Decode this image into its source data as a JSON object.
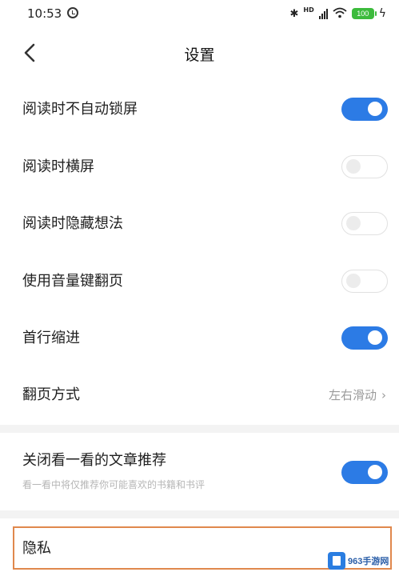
{
  "status_bar": {
    "time": "10:53",
    "network": "HD",
    "battery": "100"
  },
  "header": {
    "title": "设置"
  },
  "settings": [
    {
      "label": "阅读时不自动锁屏",
      "state": "on"
    },
    {
      "label": "阅读时横屏",
      "state": "off"
    },
    {
      "label": "阅读时隐藏想法",
      "state": "off"
    },
    {
      "label": "使用音量键翻页",
      "state": "off"
    },
    {
      "label": "首行缩进",
      "state": "on"
    },
    {
      "label": "翻页方式",
      "value": "左右滑动"
    }
  ],
  "recommend": {
    "label": "关闭看一看的文章推荐",
    "description": "看一看中将仅推荐你可能喜欢的书籍和书评",
    "state": "on"
  },
  "privacy": {
    "label": "隐私"
  },
  "watermark": {
    "text": "963手游网"
  },
  "colors": {
    "accent": "#2c7be5",
    "divider": "#f3f3f3",
    "highlight_border": "#e0884d"
  }
}
